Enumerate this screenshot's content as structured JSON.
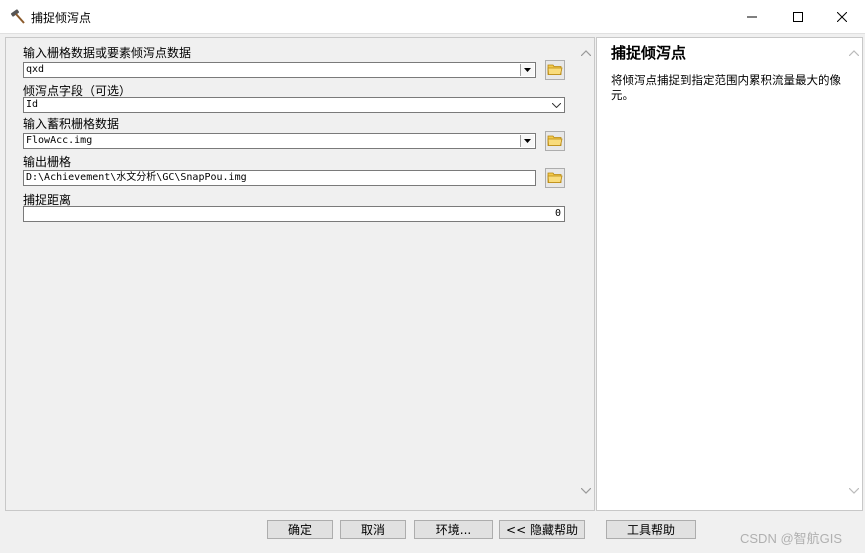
{
  "window": {
    "title": "捕捉倾泻点"
  },
  "form": {
    "input_raster_label": "输入栅格数据或要素倾泻点数据",
    "input_raster_value": "qxd",
    "pour_field_label": "倾泻点字段（可选）",
    "pour_field_value": "Id",
    "accum_label": "输入蓄积栅格数据",
    "accum_value": "FlowAcc.img",
    "output_label": "输出栅格",
    "output_value": "D:\\Achievement\\水文分析\\GC\\SnapPou.img",
    "snap_label": "捕捉距离",
    "snap_value": "0"
  },
  "help": {
    "title": "捕捉倾泻点",
    "body": "将倾泻点捕捉到指定范围内累积流量最大的像元。"
  },
  "buttons": {
    "ok": "确定",
    "cancel": "取消",
    "env": "环境...",
    "hide_help": "<< 隐藏帮助",
    "tool_help": "工具帮助"
  },
  "watermark": "CSDN @智航GIS",
  "icons": {
    "title": "hammer-icon",
    "folder": "open-folder-icon"
  }
}
